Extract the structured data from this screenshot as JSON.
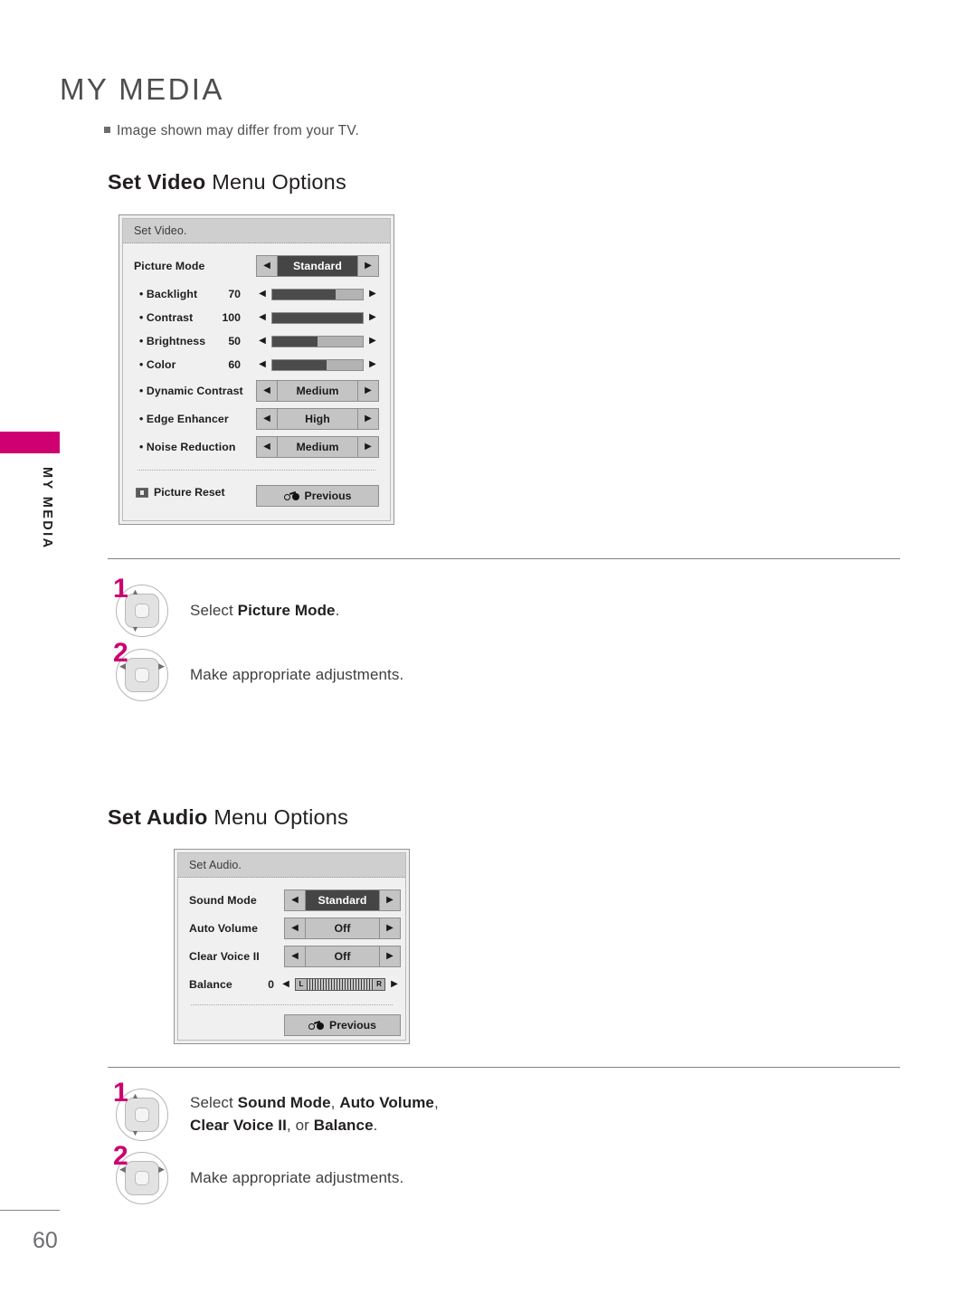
{
  "page": {
    "title": "MY MEDIA",
    "note": "Image shown may differ from your TV.",
    "chapter_tab_label": "MY MEDIA",
    "number": "60",
    "accent_color": "#ce0072"
  },
  "video_section": {
    "heading_bold": "Set Video",
    "heading_light": " Menu Options",
    "osd": {
      "header": "Set Video.",
      "picture_mode": {
        "label": "Picture Mode",
        "value": "Standard",
        "highlighted": true
      },
      "sliders": [
        {
          "label": "• Backlight",
          "value": "70",
          "percent": 70
        },
        {
          "label": "• Contrast",
          "value": "100",
          "percent": 100
        },
        {
          "label": "• Brightness",
          "value": "50",
          "percent": 50
        },
        {
          "label": "• Color",
          "value": "60",
          "percent": 60
        }
      ],
      "options": [
        {
          "label": "• Dynamic Contrast",
          "value": "Medium"
        },
        {
          "label": "• Edge Enhancer",
          "value": "High"
        },
        {
          "label": "• Noise Reduction",
          "value": "Medium"
        }
      ],
      "reset_label": "Picture Reset",
      "previous_label": "Previous",
      "arrow_left": "◀",
      "arrow_right": "▶"
    },
    "steps": [
      {
        "num": "1",
        "text_prefix": "Select ",
        "text_bold": "Picture Mode",
        "text_suffix": ".",
        "remote": "up-down-navigation"
      },
      {
        "num": "2",
        "text_prefix": "Make appropriate adjustments.",
        "text_bold": "",
        "text_suffix": "",
        "remote": "left-right-navigation"
      }
    ]
  },
  "audio_section": {
    "heading_bold": "Set Audio",
    "heading_light": " Menu Options",
    "osd": {
      "header": "Set Audio.",
      "options": [
        {
          "label": "Sound Mode",
          "value": "Standard",
          "highlighted": true
        },
        {
          "label": "Auto Volume",
          "value": "Off",
          "highlighted": false
        },
        {
          "label": "Clear Voice II",
          "value": "Off",
          "highlighted": false
        }
      ],
      "balance": {
        "label": "Balance",
        "value": "0",
        "left_cap": "L",
        "right_cap": "R"
      },
      "previous_label": "Previous",
      "arrow_left": "◀",
      "arrow_right": "▶"
    },
    "steps": [
      {
        "num": "1",
        "line1_prefix": "Select ",
        "line1_b1": "Sound Mode",
        "line1_mid": ", ",
        "line1_b2": "Auto Volume",
        "line1_suffix": ",",
        "line2_b1": "Clear Voice II",
        "line2_mid": ", or ",
        "line2_b2": "Balance",
        "line2_suffix": ".",
        "remote": "up-down-navigation"
      },
      {
        "num": "2",
        "text_prefix": "Make appropriate adjustments.",
        "remote": "left-right-navigation"
      }
    ]
  }
}
